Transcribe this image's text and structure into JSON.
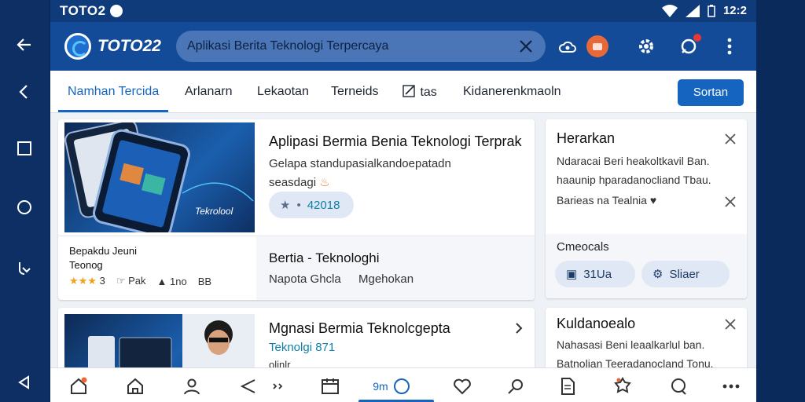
{
  "status": {
    "carrier": "TOTO2",
    "time": "12:2"
  },
  "appbar": {
    "brand": "TOTO22",
    "search_value": "Aplikasi Berita Teknologi Terpercaya"
  },
  "tabs": [
    {
      "label": "Namhan Tercida"
    },
    {
      "label": "Arlanarn"
    },
    {
      "label": "Lekaotan"
    },
    {
      "label": "Terneids"
    },
    {
      "label": "tas"
    },
    {
      "label": "Kidanerenkmaoln"
    }
  ],
  "sort_label": "Sortan",
  "card1": {
    "title": "Aplipasi Bermia  Benia Teknologi Terprak",
    "desc": "Gelapa standupasialkandoepatadn",
    "desc2": "seasdagi",
    "rating_value": "42018",
    "caption_title": "Bepakdu Jeuni",
    "caption_sub": "Teonog",
    "stat_stars": "3",
    "stat_likes": "Pak",
    "stat_views": "1no",
    "stat_extra": "BB",
    "section_title": "Bertia - Teknologhi",
    "section_left": "Napota Ghcla",
    "section_right": "Mgehokan",
    "img_caption": "Tekrolool"
  },
  "side1": {
    "title": "Herarkan",
    "line1": "Ndaracai Beri heakoltkavil Ban.",
    "line2": "haaunip hparadanocliand Tbau.",
    "line3": "Barieas na Tealnia",
    "section": "Cmeocals",
    "pill1": "31Ua",
    "pill2": "Sliaer"
  },
  "card2": {
    "title": "Mgnasi Bermia Teknolcgepta",
    "sub": "Teknolgi 871",
    "sub2": "olinlr"
  },
  "side2": {
    "title": "Kuldanoealo",
    "line1": "Nahasasi Beni leaalkarlul ban.",
    "line2": "Batnolian Teeradanocland Tonu."
  },
  "bottomnav": {
    "center_label": "9m"
  },
  "colors": {
    "accent": "#1565c0",
    "appbar": "#134b98",
    "statusbar": "#0f3b7a"
  }
}
